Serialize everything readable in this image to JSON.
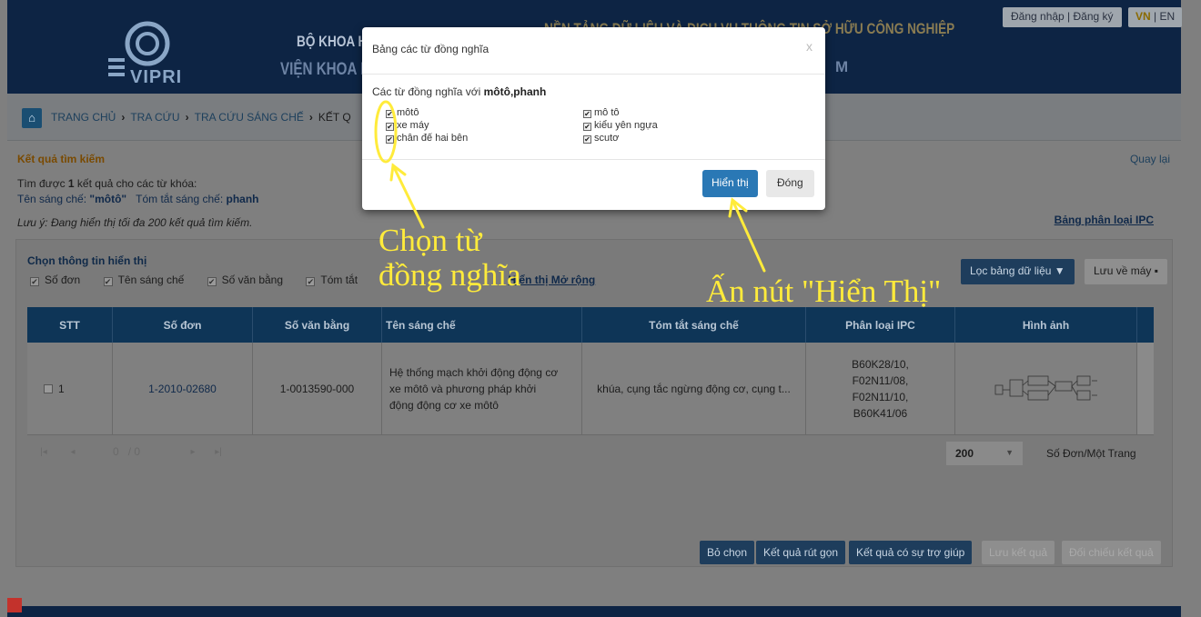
{
  "header": {
    "logo_text": "VIPRI",
    "line1": "BỘ KHOA HỌ",
    "line2": "VIỆN KHOA HỌ",
    "right1": "NỀN TẢNG DỮ LIỆU VÀ DỊCH VỤ THÔNG TIN SỞ HỮU CÔNG NGHIỆP",
    "right2": "M",
    "login": "Đăng nhập | Đăng ký",
    "lang_vn": "VN",
    "lang_sep": " | ",
    "lang_en": "EN"
  },
  "breadcrumb": {
    "items": [
      "TRANG CHỦ",
      "TRA CỨU",
      "TRA CỨU SÁNG CHẾ"
    ],
    "current": "KẾT Q"
  },
  "results": {
    "title": "Kết quả tìm kiếm",
    "back": "Quay lại",
    "found_prefix": "Tìm được ",
    "found_count": "1",
    "found_suffix": " kết quả cho các từ khóa:",
    "kw1_label": "Tên sáng chế: ",
    "kw1_value": "\"môtô\"",
    "kw2_label": "Tóm tắt sáng chế: ",
    "kw2_value": "phanh",
    "note": "Lưu ý: Đang hiển thị tối đa 200 kết quả tìm kiếm.",
    "ipc_link": "Bảng phân loại IPC"
  },
  "display_options": {
    "title": "Chọn thông tin hiển thị",
    "options": [
      "Số đơn",
      "Tên sáng chế",
      "Số văn bằng",
      "Tóm tắt"
    ],
    "extended_link": "Hiển thị Mở rộng",
    "filter_button": "Lọc bảng dữ liệu",
    "save_button": "Lưu về máy"
  },
  "table": {
    "headers": [
      "STT",
      "Số đơn",
      "Số văn bằng",
      "Tên sáng chế",
      "Tóm tắt sáng chế",
      "Phân loại IPC",
      "Hình ảnh"
    ],
    "rows": [
      {
        "stt": "1",
        "so_don": "1-2010-02680",
        "so_van_bang": "1-0013590-000",
        "ten": "Hệ thống mạch khởi động động cơ xe môtô và phương pháp khởi động động cơ xe môtô",
        "tom_tat": "khúa, cụng tắc ngừng động cơ, cụng t...",
        "ipc": "B60K28/10, F02N11/08, F02N11/10, B60K41/06"
      }
    ]
  },
  "pager": {
    "current": "0",
    "total": "/ 0",
    "per_page": "200",
    "per_page_label": "Số Đơn/Một Trang"
  },
  "bottom_buttons": {
    "clear": "Bỏ chọn",
    "short": "Kết quả rút gọn",
    "assisted": "Kết quả có sự trợ giúp",
    "save": "Lưu kết quả",
    "compare": "Đối chiếu kết quả"
  },
  "modal": {
    "title": "Bảng các từ đồng nghĩa",
    "close_x": "x",
    "syn_prefix": "Các từ đồng nghĩa với ",
    "syn_words": "môtô,phanh",
    "items_left": [
      "môtô",
      "xe máy",
      "chân đế hai bên"
    ],
    "items_right": [
      "mô tô",
      "kiểu yên ngựa",
      "scutơ"
    ],
    "show_button": "Hiển thị",
    "close_button": "Đóng"
  },
  "annotations": {
    "left_text": "Chọn từ\nđồng nghĩa",
    "left_line1": "Chọn từ",
    "left_line2": "đồng nghĩa",
    "right_text": "Ấn nút \"Hiển Thị\"",
    "color": "#ffeb3b"
  }
}
